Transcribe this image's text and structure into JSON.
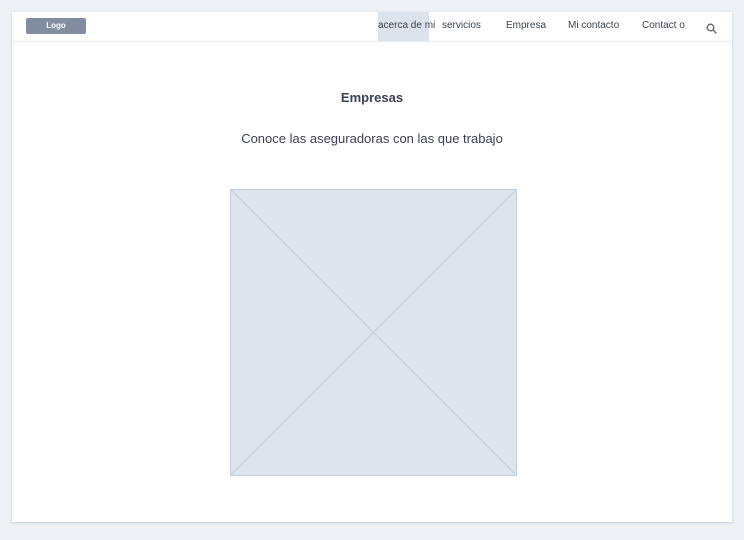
{
  "header": {
    "logo": "Logo",
    "nav": [
      {
        "label": "acerca de mi",
        "active": true
      },
      {
        "label": "servicios"
      },
      {
        "label": "Empresa"
      },
      {
        "label": "Mi contacto"
      },
      {
        "label": "Contact o"
      }
    ],
    "search_icon": "magnifier-icon"
  },
  "main": {
    "title": "Empresas",
    "subtitle": "Conoce las aseguradoras con las que trabajo",
    "image_icon": "image-placeholder"
  },
  "colors": {
    "page_background": "#eef2f7",
    "panel": "#ffffff",
    "logo_fill": "#838da0",
    "active_tab": "#dde3ec",
    "placeholder_fill": "#dde4ed",
    "placeholder_line": "#c4cdd8",
    "text": "#3b4252"
  }
}
